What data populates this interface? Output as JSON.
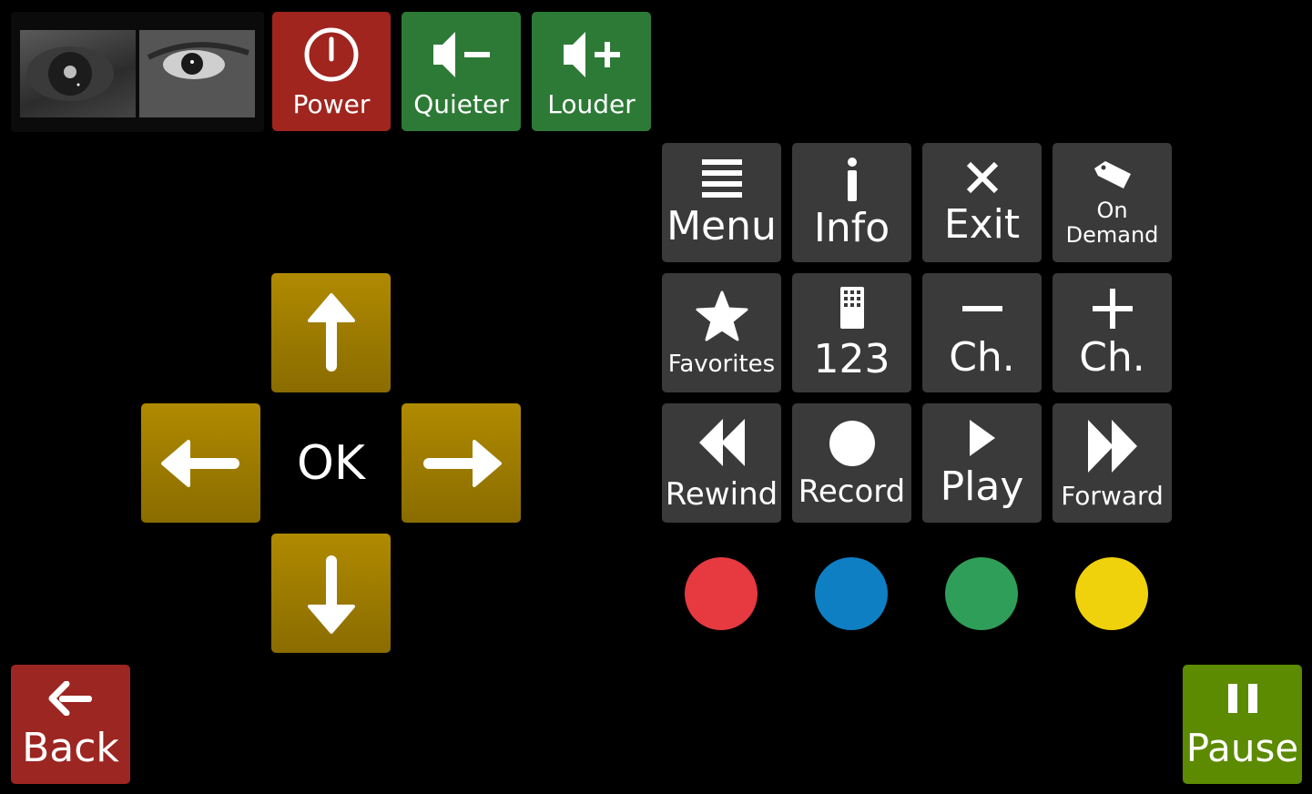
{
  "top": {
    "power_label": "Power",
    "quieter_label": "Quieter",
    "louder_label": "Louder"
  },
  "grid": {
    "menu": "Menu",
    "info": "Info",
    "exit": "Exit",
    "on_demand_line1": "On",
    "on_demand_line2": "Demand",
    "favorites": "Favorites",
    "number_pad": "123",
    "channel_down": "Ch.",
    "channel_up": "Ch.",
    "rewind": "Rewind",
    "record": "Record",
    "play": "Play",
    "forward": "Forward"
  },
  "dpad": {
    "ok_label": "OK"
  },
  "color_buttons": {
    "red": "#e63940",
    "blue": "#0f7fc4",
    "green": "#2f9e58",
    "yellow": "#efd20c"
  },
  "bottom": {
    "back_label": "Back",
    "pause_label": "Pause"
  },
  "icons": [
    "power-icon",
    "volume-down-icon",
    "volume-up-icon",
    "menu-icon",
    "info-icon",
    "close-icon",
    "tag-icon",
    "star-icon",
    "keypad-icon",
    "minus-icon",
    "plus-icon",
    "rewind-icon",
    "record-icon",
    "play-icon",
    "fast-forward-icon",
    "arrow-up-icon",
    "arrow-left-icon",
    "arrow-right-icon",
    "arrow-down-icon",
    "back-arrow-icon",
    "pause-icon"
  ]
}
